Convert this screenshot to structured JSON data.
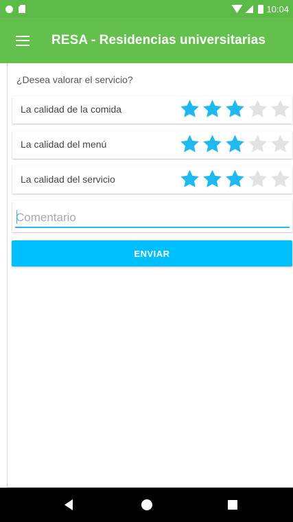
{
  "status_bar": {
    "time": "10:04"
  },
  "app_bar": {
    "title": "RESA - Residencias universitarias",
    "menu_icon": "hamburger-menu-icon"
  },
  "form": {
    "prompt": "¿Desea valorar el servicio?",
    "ratings": [
      {
        "label": "La calidad de la comida",
        "value": 3,
        "max": 5
      },
      {
        "label": "La calidad del menú",
        "value": 3,
        "max": 5
      },
      {
        "label": "La calidad del servicio",
        "value": 3,
        "max": 5
      }
    ],
    "comment": {
      "value": "",
      "placeholder": "Comentario"
    },
    "submit_label": "ENVIAR"
  },
  "colors": {
    "status_bar": "#5cbb48",
    "app_bar": "#63c04d",
    "star_filled": "#1fb8f0",
    "star_empty": "#e2e2e2",
    "button": "#00bfff",
    "input_underline": "#29b6f6"
  }
}
